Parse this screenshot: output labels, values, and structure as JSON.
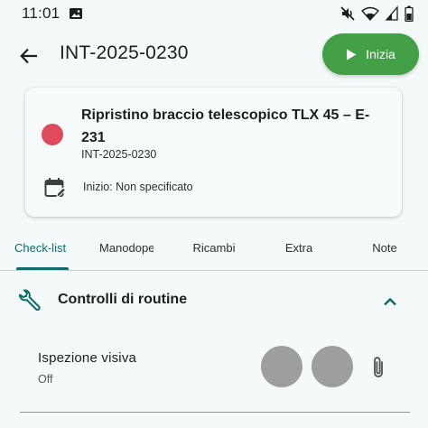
{
  "status_bar": {
    "time": "11:01",
    "icons": [
      "image-icon",
      "mute-icon",
      "wifi-icon",
      "signal-icon",
      "battery-icon"
    ]
  },
  "app_bar": {
    "title": "INT-2025-0230",
    "start_label": "Inizia"
  },
  "card": {
    "title": "Ripristino braccio telescopico TLX 45 – E-231",
    "code": "INT-2025-0230",
    "start_text": "Inizio: Non specificato",
    "priority_color": "#df4a5f"
  },
  "tabs": [
    {
      "label": "Check-list",
      "active": true
    },
    {
      "label": "Manodopera",
      "active": false
    },
    {
      "label": "Ricambi",
      "active": false
    },
    {
      "label": "Extra",
      "active": false
    },
    {
      "label": "Note",
      "active": false
    }
  ],
  "section": {
    "title": "Controlli di routine"
  },
  "checklist": [
    {
      "label": "Ispezione visiva",
      "value": "Off"
    }
  ],
  "colors": {
    "accent": "#0f6b6b",
    "start_button": "#43a047",
    "toggle_off": "#9e9e9e",
    "background": "#f4fafa"
  }
}
